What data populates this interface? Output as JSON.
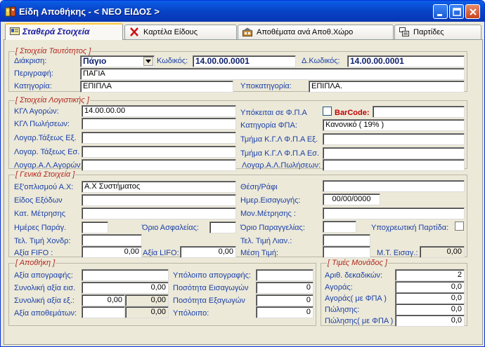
{
  "window": {
    "title": "Είδη Αποθήκης - < ΝΕΟ ΕΙΔΟΣ >"
  },
  "tabs": [
    {
      "label": "Σταθερά Στοιχεία"
    },
    {
      "label": "Καρτέλα Είδους"
    },
    {
      "label": "Αποθέματα ανά Αποθ.Χώρο"
    },
    {
      "label": "Παρτίδες"
    }
  ],
  "identity": {
    "legend": "[ Στοιχεία Ταυτότητος ]",
    "diakrisi_label": "Διάκριση:",
    "diakrisi_value": "Πάγιο",
    "kodikos_label": "Κωδικός:",
    "kodikos_value": "14.00.00.0001",
    "dkodikos_label": "Δ.Κωδικός:",
    "dkodikos_value": "14.00.00.0001",
    "perigrafi_label": "Περιγραφή:",
    "perigrafi_value": "ΠΑΓΙΑ",
    "katigoria_label": "Κατηγορία:",
    "katigoria_value": "ΕΠΙΠΛΑ",
    "ypokatigoria_label": "Υποκατηγορία:",
    "ypokatigoria_value": "ΕΠΙΠΛΑ."
  },
  "accounting": {
    "legend": "[ Στοιχεία Λογιστικής ]",
    "kgl_agoron_label": "ΚΓΛ Αγορών:",
    "kgl_agoron_value": "14.00.00.00",
    "kgl_poliseon_label": "ΚΓΛ Πωλήσεων:",
    "log_taxeos_ex_label": "Λογαρ.Τάξεως Εξ.",
    "log_taxeos_es_label": "Λογαρ. Τάξεως Εσ.",
    "log_a_agoron_label": "Λογαρ.Α.Λ.Αγορών:",
    "ypokeitai_fpa_label": "Υπόκειται σε Φ.Π.Α",
    "barcode_label": "BarCode:",
    "katigoria_fpa_label": "Κατηγορία ΦΠΑ:",
    "katigoria_fpa_value": "Κανονικό ( 19% )",
    "tmima_ex_label": "Τμήμα Κ.Γ.Λ Φ.Π.Α Εξ.",
    "tmima_es_label": "Τμήμα Κ.Γ.Λ Φ.Π.Α Εσ.",
    "log_a_poliseon_label": "Λογαρ.Α.Λ.Πωλήσεων:"
  },
  "general": {
    "legend": "[ Γενικά Στοιχεία ]",
    "exoplismou_label": "Εξ'οπλισμού Α.Χ:",
    "exoplismou_value": "Α.Χ Συστήματος",
    "eidos_exodon_label": "Είδος Εξόδων",
    "kat_metrisis_label": "Κατ. Μέτρησης",
    "imeres_parag_label": "Ημέρες Παράγ.",
    "orio_asfaleias_label": "Όριο Ασφαλείας:",
    "tel_timi_xondr_label": "Τελ. Τιμή Χονδρ:",
    "axia_fifo_label": "Αξία FIFO :",
    "axia_fifo_value": "0,00",
    "axia_lifo_label": "Αξία LIFO:",
    "axia_lifo_value": "0,00",
    "thesi_rafi_label": "Θέση/Ράφι",
    "imer_eisagogis_label": "Ημερ.Εισαγωγής:",
    "imer_eisagogis_value": "00/00/0000",
    "mon_metrisis_label": "Μον.Μέτρησης :",
    "orio_paraggelias_label": "Όριο Παραγγελίας:",
    "ypoxreotiki_partida_label": "Υποχρεωτική Παρτίδα:",
    "tel_timi_lian_label": "Τελ. Τιμή Λιαν.:",
    "mesi_timi_label": "Μέση Τιμή:",
    "m_t_eisag_label": "Μ.Τ. Εισαγ.:",
    "m_t_eisag_value": "0,00"
  },
  "warehouse": {
    "legend": "[ Αποθήκη ]",
    "axia_apografis_label": "Αξία απογραφής:",
    "synoliki_eis_label": "Συνολική αξία εισ.",
    "synoliki_eis_value": "0,00",
    "synoliki_ex_label": "Συνολική αξία εξ.:",
    "synoliki_ex_value1": "0,00",
    "synoliki_ex_value2": "0,00",
    "axia_apothematon_label": "Αξία αποθεμάτων:",
    "axia_apothematon_value": "0,00",
    "ypoloipo_apografis_label": "Υπόλοιπο απογραφής:",
    "posotita_eisagogon_label": "Ποσότητα Εισαγωγών",
    "posotita_eisagogon_value": "0",
    "posotita_exagogon_label": "Ποσότητα Εξαγωγών",
    "posotita_exagogon_value": "0",
    "ypoloipo_label": "Υπόλοιπο:",
    "ypoloipo_value": "0"
  },
  "unit_prices": {
    "legend": "[ Τιμές Μονάδος ]",
    "arith_dekadikon_label": "Αριθ. δεκαδικών:",
    "arith_dekadikon_value": "2",
    "agora_label": "Αγοράς:",
    "agora_value": "0,0",
    "agora_fpa_label": "Αγοράς( με ΦΠΑ )",
    "agora_fpa_value": "0,0",
    "polisis_label": "Πώλησης:",
    "polisis_value": "0,0",
    "polisis_fpa_label": "Πώλησης( με ΦΠΑ )",
    "polisis_fpa_value": "0,0"
  }
}
